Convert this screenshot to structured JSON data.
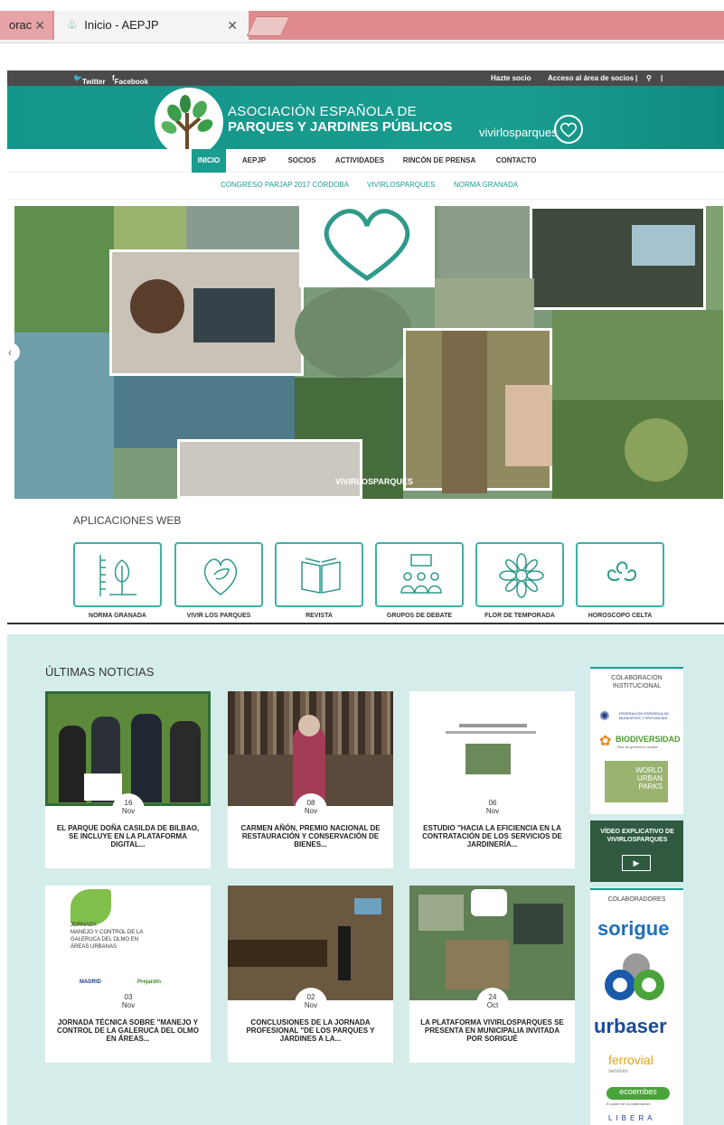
{
  "browser": {
    "tabs": [
      {
        "label": "orac"
      },
      {
        "label": "Inicio - AEPJP"
      }
    ]
  },
  "topbar": {
    "twitter": "Twitter",
    "facebook": "Facebook",
    "hazte_socio": "Hazte socio",
    "acceso": "Acceso al área de socios",
    "sep": "|"
  },
  "header": {
    "line1": "ASOCIACIÓN ESPAÑOLA DE",
    "line2": "PARQUES Y JARDINES PÚBLICOS",
    "vivir": "vivirlosparques"
  },
  "nav": {
    "items": [
      {
        "label": "INICIO"
      },
      {
        "label": "AEPJP"
      },
      {
        "label": "SOCIOS"
      },
      {
        "label": "ACTIVIDADES"
      },
      {
        "label": "RINCÓN DE PRENSA"
      },
      {
        "label": "CONTACTO"
      }
    ]
  },
  "subnav": {
    "items": [
      {
        "label": "CONGRESO PARJAP 2017 CÓRDOBA"
      },
      {
        "label": "VIVIRLOSPARQUES"
      },
      {
        "label": "NORMA GRANADA"
      }
    ]
  },
  "slider": {
    "label": "VIVIRLOSPARQUES",
    "arrow": "‹"
  },
  "apps": {
    "title": "APLICACIONES WEB",
    "items": [
      {
        "label": "NORMA GRANADA",
        "icon": "tree-ruler-icon"
      },
      {
        "label": "VIVIR LOS PARQUES",
        "icon": "heart-leaf-icon"
      },
      {
        "label": "REVISTA",
        "icon": "book-icon"
      },
      {
        "label": "GRUPOS DE DEBATE",
        "icon": "people-chat-icon"
      },
      {
        "label": "FLOR DE TEMPORADA",
        "icon": "flower-icon"
      },
      {
        "label": "HOROSCOPO CELTA",
        "icon": "triskele-icon"
      }
    ]
  },
  "news": {
    "title": "ÚLTIMAS NOTICIAS",
    "cards": [
      {
        "day": "16",
        "month": "Nov",
        "title": "EL PARQUE DOÑA CASILDA DE BILBAO, SE INCLUYE EN LA PLATAFORMA DIGITAL..."
      },
      {
        "day": "08",
        "month": "Nov",
        "title": "CARMEN AÑÓN, PREMIO NACIONAL DE RESTAURACIÓN Y CONSERVACIÓN DE BIENES..."
      },
      {
        "day": "06",
        "month": "Nov",
        "title": "ESTUDIO \"HACIA LA EFICIENCIA EN LA CONTRATACIÓN DE LOS SERVICIOS DE JARDINERÍA..."
      },
      {
        "day": "03",
        "month": "Nov",
        "title": "JORNADA TÉCNICA SOBRE \"MANEJO Y CONTROL DE LA GALERUCA DEL OLMO EN ÁREAS..."
      },
      {
        "day": "02",
        "month": "Nov",
        "title": "CONCLUSIONES DE LA JORNADA PROFESIONAL \"DE LOS PARQUES Y JARDINES A LA..."
      },
      {
        "day": "24",
        "month": "Oct",
        "title": "LA PLATAFORMA VIVIRLOSPARQUES SE PRESENTA EN MUNICIPALIA INVITADA POR SORIGUÉ"
      }
    ],
    "card_text": {
      "jornada_head": "JORNADA\nMANEJO Y CONTROL DE LA\nGALERUCA DEL OLMO EN\nÁREAS URBANAS",
      "madrid": "MADRID",
      "prejardin": "Prejardín"
    }
  },
  "sidebar": {
    "colab_inst": "COLABORACIÓN INSTITUCIONAL",
    "femp": "FEDERACIÓN ESPAÑOLA DE MUNICIPIOS Y PROVINCIAS",
    "biodiversidad": "BIODIVERSIDAD",
    "bio_sub": "Red de gobiernos locales",
    "wup1": "WORLD",
    "wup2": "URBAN",
    "wup3": "PARKS",
    "video": "VÍDEO EXPLICATIVO DE VIVIRLOSPARQUES",
    "colaboradores": "COLABORADORES",
    "sorigue": "sorigue",
    "urbaser": "urbaser",
    "ferrovial": "ferrovial",
    "services": "services",
    "ecoembes": "ecoembes",
    "eco_sub": "El poder de la colaboración",
    "last": "LIBERA"
  },
  "colors": {
    "teal": "#1a9d8f",
    "tab_strip": "#e08c8f",
    "news_bg": "#d5edea"
  }
}
